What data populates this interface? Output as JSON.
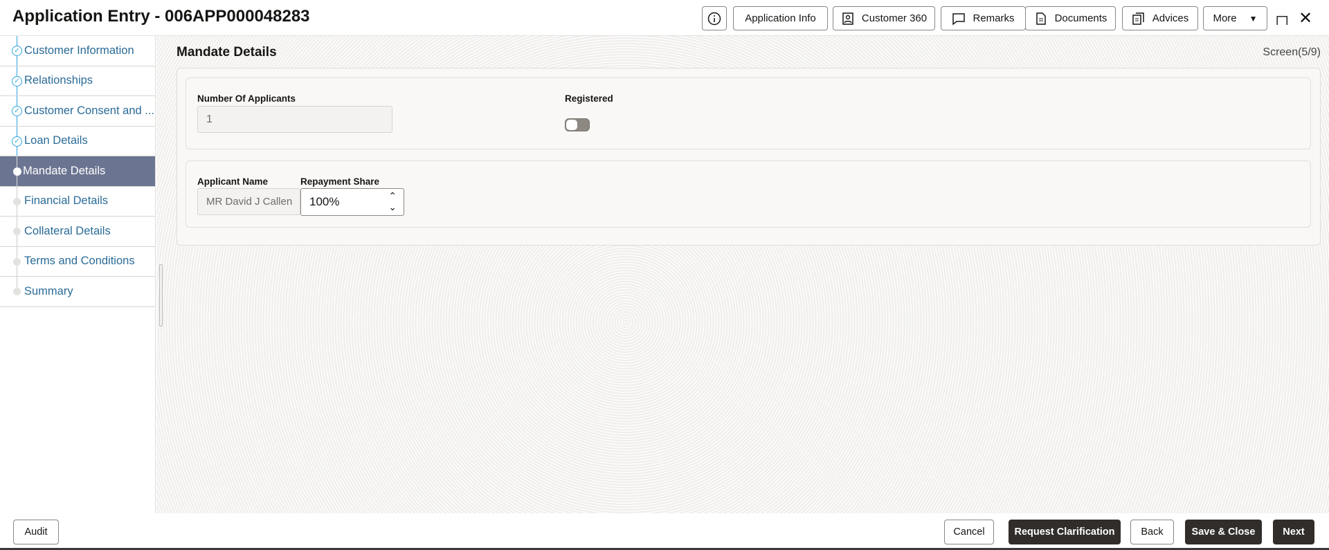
{
  "header": {
    "title": "Application Entry - 006APP000048283",
    "buttons": {
      "application_info": "Application Info",
      "customer_360": "Customer 360",
      "remarks": "Remarks",
      "documents": "Documents",
      "advices": "Advices",
      "more": "More"
    }
  },
  "sidebar": {
    "items": [
      {
        "label": "Customer Information",
        "status": "completed"
      },
      {
        "label": "Relationships",
        "status": "completed"
      },
      {
        "label": "Customer Consent and ...",
        "status": "completed"
      },
      {
        "label": "Loan Details",
        "status": "completed"
      },
      {
        "label": "Mandate Details",
        "status": "active"
      },
      {
        "label": "Financial Details",
        "status": "pending"
      },
      {
        "label": "Collateral Details",
        "status": "pending"
      },
      {
        "label": "Terms and Conditions",
        "status": "pending"
      },
      {
        "label": "Summary",
        "status": "pending"
      }
    ]
  },
  "main": {
    "title": "Mandate Details",
    "screen_indicator": "Screen(5/9)",
    "number_of_applicants_label": "Number Of Applicants",
    "number_of_applicants_value": "1",
    "registered_label": "Registered",
    "registered_on": false,
    "applicant_name_label": "Applicant Name",
    "repayment_share_label": "Repayment Share",
    "applicant_name_value": "MR David J Callen",
    "repayment_share_value": "100%"
  },
  "footer": {
    "audit": "Audit",
    "cancel": "Cancel",
    "request_clarification": "Request Clarification",
    "back": "Back",
    "save_close": "Save & Close",
    "next": "Next"
  },
  "colors": {
    "active_nav": "#6b7591",
    "primary_button": "#312d2a",
    "link": "#2b6b97",
    "step_complete": "#2ea3dd"
  }
}
